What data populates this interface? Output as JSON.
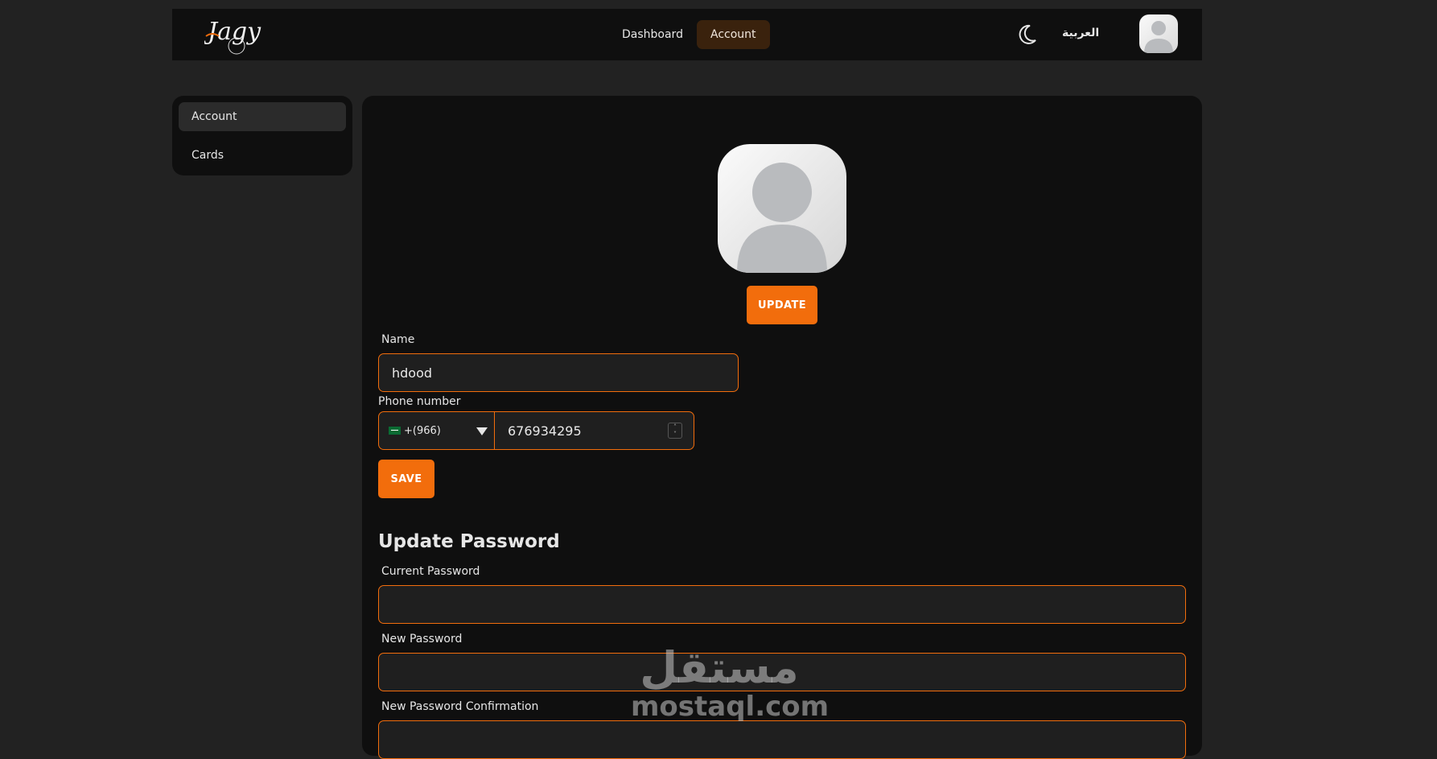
{
  "header": {
    "logo_text": "Jagy",
    "nav": [
      {
        "label": "Dashboard"
      },
      {
        "label": "Account"
      }
    ],
    "language_toggle": "العربية",
    "theme_icon": "moon-icon"
  },
  "sidebar": {
    "items": [
      {
        "label": "Account",
        "active": true
      },
      {
        "label": "Cards",
        "active": false
      }
    ]
  },
  "profile": {
    "update_button": "UPDATE"
  },
  "form": {
    "name_label": "Name",
    "name_value": "hdood",
    "phone_label": "Phone number",
    "country_code": "+(966)",
    "phone_value": "676934295",
    "save_button": "SAVE"
  },
  "password": {
    "title": "Update Password",
    "current_label": "Current Password",
    "new_label": "New Password",
    "confirm_label": "New Password Confirmation"
  },
  "watermark": {
    "arabic": "مستقل",
    "latin": "mostaql.com"
  },
  "colors": {
    "accent": "#f26d0c",
    "background": "#222222",
    "panel": "#0f0f0f"
  }
}
